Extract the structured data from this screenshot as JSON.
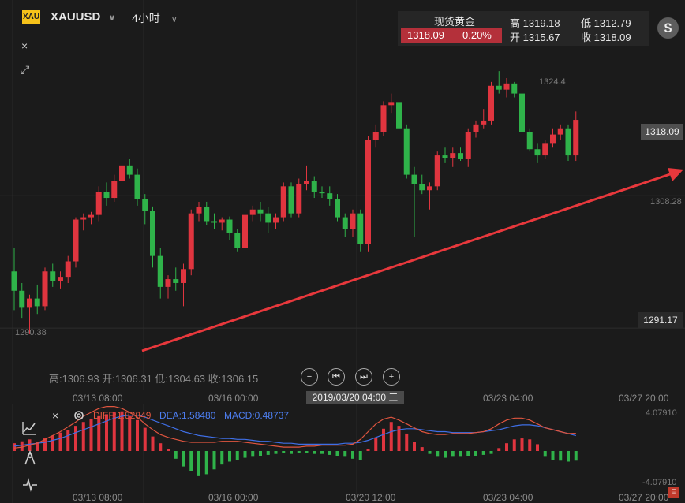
{
  "header": {
    "logo_text": "XAU",
    "symbol": "XAUUSD",
    "interval": "4小时",
    "chevron": "∨"
  },
  "quote": {
    "title": "现货黄金",
    "price": "1318.09",
    "change_pct": "0.20%",
    "high_label": "高",
    "high": "1319.18",
    "low_label": "低",
    "low": "1312.79",
    "open_label": "开",
    "open": "1315.67",
    "close_label": "收",
    "close": "1318.09"
  },
  "tools": {
    "dollar_icon": "$",
    "close_icon": "×",
    "expand_icon": "⤢"
  },
  "price_labels": {
    "high_marker": "1324.4",
    "low_marker": "1290.38",
    "current_tag": "1318.09",
    "mid_level": "1308.28",
    "low_tag": "1291.17"
  },
  "ohlc_line": "高:1306.93 开:1306.31 低:1304.63 收:1306.15",
  "controls": {
    "zoom_out": "−",
    "prev": "⏮",
    "next": "⏭",
    "zoom_in": "+"
  },
  "x_axis": {
    "labels": [
      "03/13 08:00",
      "03/16 00:00",
      "03/23 04:00",
      "03/27 20:00"
    ],
    "crosshair": "2019/03/20 04:00 三"
  },
  "macd": {
    "diff": "DIFF:1.82849",
    "dea": "DEA:1.58480",
    "macd": "MACD:0.48737",
    "top_value": "4.07910",
    "bottom_value": "-4.07910",
    "axis_labels": [
      "03/13 08:00",
      "03/16 00:00",
      "03/20 12:00",
      "03/23 04:00",
      "03/27 20:00"
    ],
    "corner_icon": "⌸"
  },
  "colors": {
    "up": "#e0353f",
    "down": "#2fb34a",
    "trend": "#e8383c",
    "dea": "#3f6fe6"
  },
  "chart_data": {
    "type": "candlestick",
    "title": "",
    "y_range": [
      1286.5,
      1329
    ],
    "candles": [
      {
        "o": 1298.5,
        "h": 1301.5,
        "l": 1293.5,
        "c": 1296.0
      },
      {
        "o": 1296.0,
        "h": 1297.0,
        "l": 1292.5,
        "c": 1293.8
      },
      {
        "o": 1293.8,
        "h": 1295.5,
        "l": 1290.38,
        "c": 1295.0
      },
      {
        "o": 1295.0,
        "h": 1296.8,
        "l": 1293.0,
        "c": 1294.0
      },
      {
        "o": 1294.0,
        "h": 1299.0,
        "l": 1293.5,
        "c": 1298.5
      },
      {
        "o": 1298.5,
        "h": 1299.5,
        "l": 1296.5,
        "c": 1297.3
      },
      {
        "o": 1297.3,
        "h": 1298.5,
        "l": 1296.3,
        "c": 1297.8
      },
      {
        "o": 1297.8,
        "h": 1300.5,
        "l": 1297.0,
        "c": 1299.8
      },
      {
        "o": 1299.8,
        "h": 1305.5,
        "l": 1299.0,
        "c": 1305.2
      },
      {
        "o": 1305.2,
        "h": 1306.0,
        "l": 1303.8,
        "c": 1305.5
      },
      {
        "o": 1305.5,
        "h": 1306.2,
        "l": 1304.6,
        "c": 1305.8
      },
      {
        "o": 1305.8,
        "h": 1309.5,
        "l": 1305.0,
        "c": 1308.8
      },
      {
        "o": 1308.8,
        "h": 1310.0,
        "l": 1307.0,
        "c": 1308.0
      },
      {
        "o": 1308.0,
        "h": 1311.0,
        "l": 1307.5,
        "c": 1310.2
      },
      {
        "o": 1310.2,
        "h": 1312.5,
        "l": 1309.0,
        "c": 1312.2
      },
      {
        "o": 1312.2,
        "h": 1313.0,
        "l": 1310.5,
        "c": 1311.0
      },
      {
        "o": 1311.0,
        "h": 1311.8,
        "l": 1307.0,
        "c": 1307.8
      },
      {
        "o": 1307.8,
        "h": 1308.5,
        "l": 1304.6,
        "c": 1306.3
      },
      {
        "o": 1306.3,
        "h": 1306.9,
        "l": 1299.0,
        "c": 1300.5
      },
      {
        "o": 1300.5,
        "h": 1301.5,
        "l": 1295.0,
        "c": 1296.5
      },
      {
        "o": 1296.5,
        "h": 1298.0,
        "l": 1295.0,
        "c": 1297.5
      },
      {
        "o": 1297.5,
        "h": 1299.0,
        "l": 1296.0,
        "c": 1297.0
      },
      {
        "o": 1297.0,
        "h": 1299.5,
        "l": 1294.0,
        "c": 1298.8
      },
      {
        "o": 1298.8,
        "h": 1306.5,
        "l": 1298.0,
        "c": 1306.0
      },
      {
        "o": 1306.0,
        "h": 1307.5,
        "l": 1305.0,
        "c": 1306.8
      },
      {
        "o": 1306.8,
        "h": 1307.5,
        "l": 1304.5,
        "c": 1305.0
      },
      {
        "o": 1305.0,
        "h": 1306.0,
        "l": 1304.0,
        "c": 1304.8
      },
      {
        "o": 1304.8,
        "h": 1305.5,
        "l": 1303.8,
        "c": 1305.2
      },
      {
        "o": 1305.2,
        "h": 1305.6,
        "l": 1302.5,
        "c": 1303.5
      },
      {
        "o": 1303.5,
        "h": 1304.0,
        "l": 1301.0,
        "c": 1301.5
      },
      {
        "o": 1301.5,
        "h": 1306.0,
        "l": 1301.0,
        "c": 1305.8
      },
      {
        "o": 1305.8,
        "h": 1307.0,
        "l": 1305.0,
        "c": 1306.5
      },
      {
        "o": 1306.5,
        "h": 1307.5,
        "l": 1305.0,
        "c": 1306.0
      },
      {
        "o": 1306.0,
        "h": 1306.8,
        "l": 1303.5,
        "c": 1304.8
      },
      {
        "o": 1304.8,
        "h": 1306.0,
        "l": 1304.0,
        "c": 1305.5
      },
      {
        "o": 1305.5,
        "h": 1310.0,
        "l": 1305.0,
        "c": 1309.5
      },
      {
        "o": 1309.5,
        "h": 1310.0,
        "l": 1305.5,
        "c": 1306.0
      },
      {
        "o": 1306.0,
        "h": 1310.5,
        "l": 1305.5,
        "c": 1309.8
      },
      {
        "o": 1309.8,
        "h": 1312.2,
        "l": 1309.0,
        "c": 1310.2
      },
      {
        "o": 1310.2,
        "h": 1310.8,
        "l": 1308.0,
        "c": 1308.8
      },
      {
        "o": 1308.8,
        "h": 1309.5,
        "l": 1308.0,
        "c": 1308.6
      },
      {
        "o": 1308.6,
        "h": 1309.5,
        "l": 1307.0,
        "c": 1307.8
      },
      {
        "o": 1307.8,
        "h": 1308.5,
        "l": 1305.0,
        "c": 1305.5
      },
      {
        "o": 1305.5,
        "h": 1306.0,
        "l": 1303.0,
        "c": 1304.0
      },
      {
        "o": 1304.0,
        "h": 1306.5,
        "l": 1303.0,
        "c": 1306.0
      },
      {
        "o": 1306.0,
        "h": 1306.5,
        "l": 1301.0,
        "c": 1302.0
      },
      {
        "o": 1302.0,
        "h": 1316.0,
        "l": 1301.0,
        "c": 1315.5
      },
      {
        "o": 1315.5,
        "h": 1317.5,
        "l": 1314.5,
        "c": 1316.5
      },
      {
        "o": 1316.5,
        "h": 1320.5,
        "l": 1316.0,
        "c": 1320.0
      },
      {
        "o": 1320.0,
        "h": 1321.5,
        "l": 1319.0,
        "c": 1320.3
      },
      {
        "o": 1320.3,
        "h": 1321.0,
        "l": 1316.5,
        "c": 1317.0
      },
      {
        "o": 1317.0,
        "h": 1317.5,
        "l": 1310.5,
        "c": 1311.0
      },
      {
        "o": 1311.0,
        "h": 1312.0,
        "l": 1303.0,
        "c": 1309.8
      },
      {
        "o": 1309.8,
        "h": 1311.0,
        "l": 1308.5,
        "c": 1309.0
      },
      {
        "o": 1309.0,
        "h": 1310.0,
        "l": 1306.5,
        "c": 1309.5
      },
      {
        "o": 1309.5,
        "h": 1314.0,
        "l": 1309.0,
        "c": 1313.5
      },
      {
        "o": 1313.5,
        "h": 1314.5,
        "l": 1312.5,
        "c": 1313.2
      },
      {
        "o": 1313.2,
        "h": 1314.5,
        "l": 1312.0,
        "c": 1313.8
      },
      {
        "o": 1313.8,
        "h": 1314.5,
        "l": 1312.8,
        "c": 1313.0
      },
      {
        "o": 1313.0,
        "h": 1317.0,
        "l": 1312.0,
        "c": 1316.5
      },
      {
        "o": 1316.5,
        "h": 1318.0,
        "l": 1315.8,
        "c": 1317.5
      },
      {
        "o": 1317.5,
        "h": 1319.5,
        "l": 1317.0,
        "c": 1318.0
      },
      {
        "o": 1318.0,
        "h": 1323.0,
        "l": 1317.5,
        "c": 1322.5
      },
      {
        "o": 1322.5,
        "h": 1324.4,
        "l": 1321.5,
        "c": 1322.0
      },
      {
        "o": 1322.0,
        "h": 1323.5,
        "l": 1321.0,
        "c": 1322.8
      },
      {
        "o": 1322.8,
        "h": 1323.0,
        "l": 1321.0,
        "c": 1321.5
      },
      {
        "o": 1321.5,
        "h": 1321.8,
        "l": 1316.0,
        "c": 1316.5
      },
      {
        "o": 1316.5,
        "h": 1317.0,
        "l": 1314.0,
        "c": 1314.3
      },
      {
        "o": 1314.3,
        "h": 1315.0,
        "l": 1312.5,
        "c": 1313.5
      },
      {
        "o": 1313.5,
        "h": 1315.5,
        "l": 1313.0,
        "c": 1315.0
      },
      {
        "o": 1315.0,
        "h": 1317.0,
        "l": 1314.5,
        "c": 1316.2
      },
      {
        "o": 1316.2,
        "h": 1317.5,
        "l": 1315.5,
        "c": 1317.0
      },
      {
        "o": 1317.0,
        "h": 1317.5,
        "l": 1312.8,
        "c": 1313.5
      },
      {
        "o": 1313.5,
        "h": 1319.18,
        "l": 1312.79,
        "c": 1318.09
      }
    ],
    "macd_hist": [
      0.8,
      1.0,
      1.2,
      0.9,
      1.3,
      1.6,
      1.9,
      2.2,
      2.6,
      3.0,
      3.3,
      3.6,
      3.8,
      4.0,
      4.1,
      3.6,
      3.2,
      2.4,
      1.5,
      0.8,
      0.2,
      -0.8,
      -1.6,
      -2.1,
      -2.6,
      -2.4,
      -1.9,
      -1.4,
      -1.1,
      -0.9,
      -0.7,
      -0.6,
      -0.5,
      -0.4,
      -0.3,
      -0.2,
      -0.3,
      -0.2,
      -0.2,
      -0.3,
      -0.3,
      -0.4,
      -0.5,
      -0.6,
      -0.8,
      -0.9,
      0.2,
      1.4,
      2.3,
      3.0,
      2.6,
      1.8,
      0.9,
      0.4,
      -0.3,
      -0.6,
      -0.7,
      -0.6,
      -0.6,
      -0.5,
      -0.5,
      -0.4,
      -0.3,
      0.3,
      0.8,
      1.2,
      1.3,
      1.2,
      0.7,
      -0.6,
      -0.9,
      -1.0,
      -1.1,
      -1.0
    ],
    "diff_line": [
      0.3,
      0.4,
      0.6,
      0.8,
      1.2,
      1.6,
      2.0,
      2.5,
      3.0,
      3.6,
      4.0,
      4.4,
      4.6,
      4.6,
      4.4,
      4.0,
      3.5,
      2.8,
      2.2,
      1.7,
      1.4,
      1.2,
      1.0,
      0.9,
      0.9,
      0.9,
      0.9,
      1.0,
      1.0,
      1.0,
      0.9,
      0.8,
      0.7,
      0.6,
      0.5,
      0.4,
      0.4,
      0.4,
      0.5,
      0.5,
      0.6,
      0.6,
      0.6,
      0.6,
      0.7,
      1.2,
      2.0,
      2.8,
      3.3,
      3.5,
      3.2,
      2.8,
      2.4,
      2.0,
      1.8,
      1.7,
      1.7,
      1.8,
      1.8,
      1.8,
      1.9,
      2.0,
      2.3,
      2.8,
      3.2,
      3.4,
      3.4,
      3.2,
      2.8,
      2.4,
      2.2,
      2.0,
      1.8,
      1.83
    ],
    "dea_line": [
      0.5,
      0.6,
      0.7,
      0.8,
      0.9,
      1.1,
      1.3,
      1.6,
      1.9,
      2.2,
      2.5,
      2.8,
      3.1,
      3.4,
      3.6,
      3.7,
      3.7,
      3.5,
      3.2,
      2.9,
      2.6,
      2.3,
      2.0,
      1.8,
      1.6,
      1.5,
      1.4,
      1.3,
      1.3,
      1.2,
      1.2,
      1.1,
      1.0,
      1.0,
      0.9,
      0.8,
      0.8,
      0.7,
      0.7,
      0.7,
      0.7,
      0.7,
      0.7,
      0.8,
      0.8,
      0.9,
      1.1,
      1.4,
      1.7,
      2.0,
      2.2,
      2.3,
      2.3,
      2.2,
      2.1,
      2.0,
      2.0,
      1.9,
      1.9,
      1.9,
      1.9,
      2.0,
      2.1,
      2.2,
      2.4,
      2.6,
      2.7,
      2.7,
      2.6,
      2.4,
      2.2,
      2.0,
      1.8,
      1.58
    ],
    "macd_range": [
      -4.0791,
      4.0791
    ]
  }
}
